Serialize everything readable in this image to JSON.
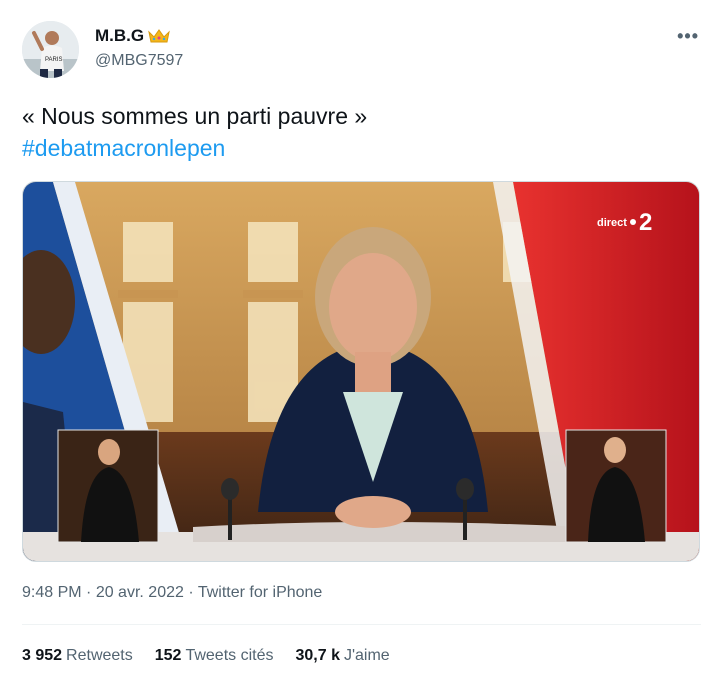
{
  "author": {
    "display_name": "M.B.G",
    "handle": "@MBG7597",
    "avatar_text": "PARIS"
  },
  "tweet": {
    "text": "« Nous sommes un parti pauvre »",
    "hashtag": "#debatmacronlepen"
  },
  "media": {
    "channel_label": "direct",
    "channel_number": "2"
  },
  "meta": {
    "time": "9:48 PM",
    "separator": " · ",
    "date": "20 avr. 2022",
    "source": "Twitter for iPhone"
  },
  "stats": [
    {
      "count": "3 952",
      "label": "Retweets"
    },
    {
      "count": "152",
      "label": "Tweets cités"
    },
    {
      "count": "30,7 k",
      "label": "J'aime"
    }
  ],
  "colors": {
    "link": "#1d9bf0",
    "secondary_text": "#536471",
    "primary_text": "#0f1419"
  },
  "icons": [
    "crown-icon",
    "more-icon"
  ]
}
